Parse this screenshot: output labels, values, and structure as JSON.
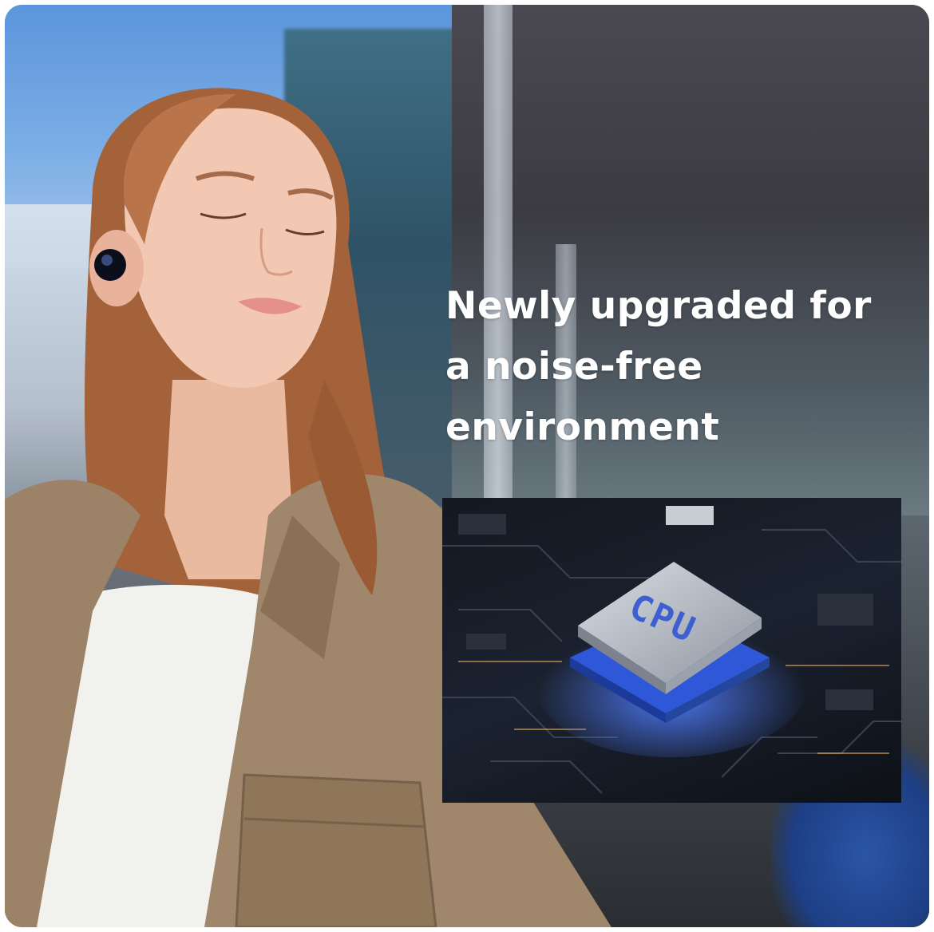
{
  "headline": {
    "line1": "Newly upgraded for",
    "line2": "a noise-free",
    "line3": "environment"
  },
  "chip": {
    "label": "CPU",
    "glow_color": "#4f7dff"
  },
  "colors": {
    "headline_text": "#ffffff",
    "jacket": "#9c8266",
    "shirt": "#f1f1ee"
  }
}
